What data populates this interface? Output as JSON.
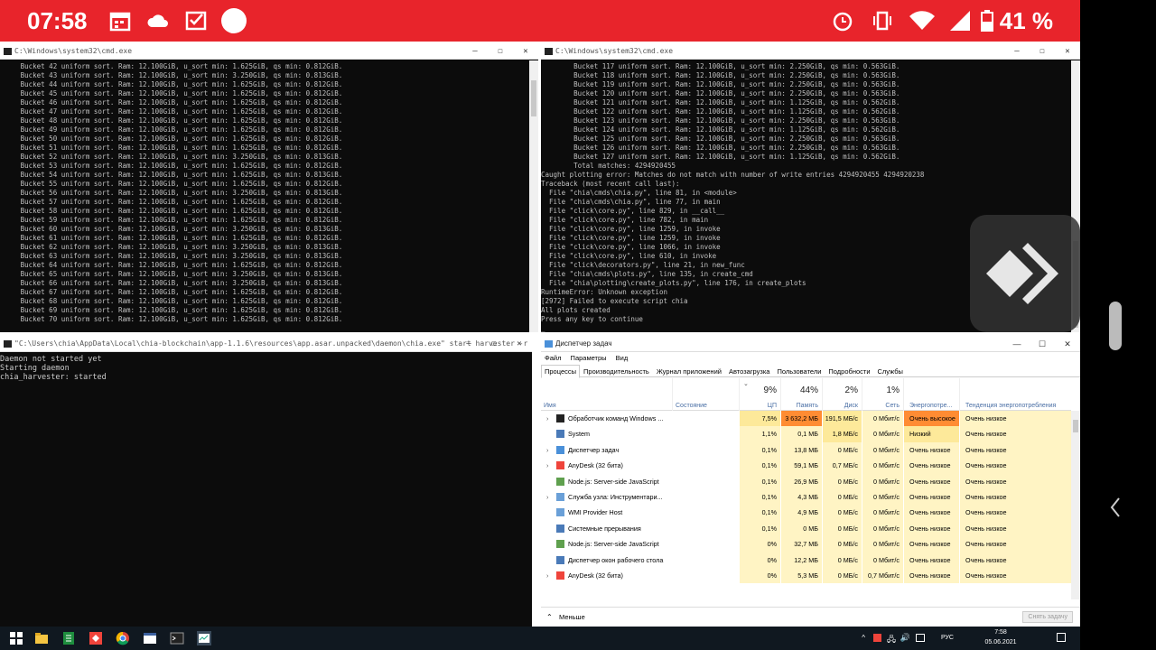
{
  "status_bar": {
    "time": "07:58",
    "battery": "41 %"
  },
  "cmd1": {
    "title": "C:\\Windows\\system32\\cmd.exe",
    "lines": [
      "     Bucket 42 uniform sort. Ram: 12.100GiB, u_sort min: 1.625GiB, qs min: 0.812GiB.",
      "     Bucket 43 uniform sort. Ram: 12.100GiB, u_sort min: 3.250GiB, qs min: 0.813GiB.",
      "     Bucket 44 uniform sort. Ram: 12.100GiB, u_sort min: 1.625GiB, qs min: 0.812GiB.",
      "     Bucket 45 uniform sort. Ram: 12.100GiB, u_sort min: 1.625GiB, qs min: 0.812GiB.",
      "     Bucket 46 uniform sort. Ram: 12.100GiB, u_sort min: 1.625GiB, qs min: 0.812GiB.",
      "     Bucket 47 uniform sort. Ram: 12.100GiB, u_sort min: 1.625GiB, qs min: 0.812GiB.",
      "     Bucket 48 uniform sort. Ram: 12.100GiB, u_sort min: 1.625GiB, qs min: 0.812GiB.",
      "     Bucket 49 uniform sort. Ram: 12.100GiB, u_sort min: 1.625GiB, qs min: 0.812GiB.",
      "     Bucket 50 uniform sort. Ram: 12.100GiB, u_sort min: 1.625GiB, qs min: 0.812GiB.",
      "     Bucket 51 uniform sort. Ram: 12.100GiB, u_sort min: 1.625GiB, qs min: 0.812GiB.",
      "     Bucket 52 uniform sort. Ram: 12.100GiB, u_sort min: 3.250GiB, qs min: 0.813GiB.",
      "     Bucket 53 uniform sort. Ram: 12.100GiB, u_sort min: 1.625GiB, qs min: 0.812GiB.",
      "     Bucket 54 uniform sort. Ram: 12.100GiB, u_sort min: 1.625GiB, qs min: 0.813GiB.",
      "     Bucket 55 uniform sort. Ram: 12.100GiB, u_sort min: 1.625GiB, qs min: 0.812GiB.",
      "     Bucket 56 uniform sort. Ram: 12.100GiB, u_sort min: 3.250GiB, qs min: 0.813GiB.",
      "     Bucket 57 uniform sort. Ram: 12.100GiB, u_sort min: 1.625GiB, qs min: 0.812GiB.",
      "     Bucket 58 uniform sort. Ram: 12.100GiB, u_sort min: 1.625GiB, qs min: 0.812GiB.",
      "     Bucket 59 uniform sort. Ram: 12.100GiB, u_sort min: 1.625GiB, qs min: 0.812GiB.",
      "     Bucket 60 uniform sort. Ram: 12.100GiB, u_sort min: 3.250GiB, qs min: 0.813GiB.",
      "     Bucket 61 uniform sort. Ram: 12.100GiB, u_sort min: 1.625GiB, qs min: 0.812GiB.",
      "     Bucket 62 uniform sort. Ram: 12.100GiB, u_sort min: 3.250GiB, qs min: 0.813GiB.",
      "     Bucket 63 uniform sort. Ram: 12.100GiB, u_sort min: 3.250GiB, qs min: 0.813GiB.",
      "     Bucket 64 uniform sort. Ram: 12.100GiB, u_sort min: 1.625GiB, qs min: 0.812GiB.",
      "     Bucket 65 uniform sort. Ram: 12.100GiB, u_sort min: 3.250GiB, qs min: 0.813GiB.",
      "     Bucket 66 uniform sort. Ram: 12.100GiB, u_sort min: 3.250GiB, qs min: 0.813GiB.",
      "     Bucket 67 uniform sort. Ram: 12.100GiB, u_sort min: 1.625GiB, qs min: 0.812GiB.",
      "     Bucket 68 uniform sort. Ram: 12.100GiB, u_sort min: 1.625GiB, qs min: 0.812GiB.",
      "     Bucket 69 uniform sort. Ram: 12.100GiB, u_sort min: 1.625GiB, qs min: 0.812GiB.",
      "     Bucket 70 uniform sort. Ram: 12.100GiB, u_sort min: 1.625GiB, qs min: 0.812GiB."
    ]
  },
  "cmd2": {
    "title": "C:\\Windows\\system32\\cmd.exe",
    "lines": [
      "        Bucket 117 uniform sort. Ram: 12.100GiB, u_sort min: 2.250GiB, qs min: 0.563GiB.",
      "        Bucket 118 uniform sort. Ram: 12.100GiB, u_sort min: 2.250GiB, qs min: 0.563GiB.",
      "        Bucket 119 uniform sort. Ram: 12.100GiB, u_sort min: 2.250GiB, qs min: 0.563GiB.",
      "        Bucket 120 uniform sort. Ram: 12.100GiB, u_sort min: 2.250GiB, qs min: 0.563GiB.",
      "        Bucket 121 uniform sort. Ram: 12.100GiB, u_sort min: 1.125GiB, qs min: 0.562GiB.",
      "        Bucket 122 uniform sort. Ram: 12.100GiB, u_sort min: 1.125GiB, qs min: 0.562GiB.",
      "        Bucket 123 uniform sort. Ram: 12.100GiB, u_sort min: 2.250GiB, qs min: 0.563GiB.",
      "        Bucket 124 uniform sort. Ram: 12.100GiB, u_sort min: 1.125GiB, qs min: 0.562GiB.",
      "        Bucket 125 uniform sort. Ram: 12.100GiB, u_sort min: 2.250GiB, qs min: 0.563GiB.",
      "        Bucket 126 uniform sort. Ram: 12.100GiB, u_sort min: 2.250GiB, qs min: 0.563GiB.",
      "        Bucket 127 uniform sort. Ram: 12.100GiB, u_sort min: 1.125GiB, qs min: 0.562GiB.",
      "        Total matches: 4294920455",
      "Caught plotting error: Matches do not match with number of write entries 4294920455 4294920238",
      "Traceback (most recent call last):",
      "  File \"chia\\cmds\\chia.py\", line 81, in <module>",
      "  File \"chia\\cmds\\chia.py\", line 77, in main",
      "  File \"click\\core.py\", line 829, in __call__",
      "  File \"click\\core.py\", line 782, in main",
      "  File \"click\\core.py\", line 1259, in invoke",
      "  File \"click\\core.py\", line 1259, in invoke",
      "  File \"click\\core.py\", line 1066, in invoke",
      "  File \"click\\core.py\", line 610, in invoke",
      "  File \"click\\decorators.py\", line 21, in new_func",
      "  File \"chia\\cmds\\plots.py\", line 135, in create_cmd",
      "  File \"chia\\plotting\\create_plots.py\", line 176, in create_plots",
      "RuntimeError: Unknown exception",
      "[2972] Failed to execute script chia",
      "All plots created",
      "Press any key to continue",
      "_"
    ]
  },
  "cmd3": {
    "title": "\"C:\\Users\\chia\\AppData\\Local\\chia-blockchain\\app-1.1.6\\resources\\app.asar.unpacked\\daemon\\chia.exe\"  start harvester -r",
    "lines": [
      "Daemon not started yet",
      "Starting daemon",
      "chia_harvester: started"
    ]
  },
  "taskmgr": {
    "title": "Диспетчер задач",
    "menu": [
      "Файл",
      "Параметры",
      "Вид"
    ],
    "tabs": [
      "Процессы",
      "Производительность",
      "Журнал приложений",
      "Автозагрузка",
      "Пользователи",
      "Подробности",
      "Службы"
    ],
    "headers": {
      "name": "Имя",
      "state": "Состояние",
      "cpu_pct": "9%",
      "cpu": "ЦП",
      "mem_pct": "44%",
      "mem": "Память",
      "disk_pct": "2%",
      "disk": "Диск",
      "net_pct": "1%",
      "net": "Сеть",
      "power": "Энергопотре...",
      "power_trend": "Тенденция энергопотребления"
    },
    "rows": [
      {
        "name": "Обработчик команд Windows ...",
        "exp": true,
        "cpu": "7,5%",
        "mem": "3 632,2 МБ",
        "disk": "191,5 МБ/с",
        "net": "0 Мбит/с",
        "power": "Очень высокое",
        "trend": "Очень низкое",
        "icon": "cmd-icon"
      },
      {
        "name": "System",
        "exp": false,
        "cpu": "1,1%",
        "mem": "0,1 МБ",
        "disk": "1,8 МБ/с",
        "net": "0 Мбит/с",
        "power": "Низкий",
        "trend": "Очень низкое",
        "icon": "system-icon"
      },
      {
        "name": "Диспетчер задач",
        "exp": true,
        "cpu": "0,1%",
        "mem": "13,8 МБ",
        "disk": "0 МБ/с",
        "net": "0 Мбит/с",
        "power": "Очень низкое",
        "trend": "Очень низкое",
        "icon": "taskmgr-icon"
      },
      {
        "name": "AnyDesk (32 бита)",
        "exp": true,
        "cpu": "0,1%",
        "mem": "59,1 МБ",
        "disk": "0,7 МБ/с",
        "net": "0 Мбит/с",
        "power": "Очень низкое",
        "trend": "Очень низкое",
        "icon": "anydesk-icon"
      },
      {
        "name": "Node.js: Server-side JavaScript",
        "exp": false,
        "cpu": "0,1%",
        "mem": "26,9 МБ",
        "disk": "0 МБ/с",
        "net": "0 Мбит/с",
        "power": "Очень низкое",
        "trend": "Очень низкое",
        "icon": "nodejs-icon"
      },
      {
        "name": "Служба узла: Инструментари...",
        "exp": true,
        "cpu": "0,1%",
        "mem": "4,3 МБ",
        "disk": "0 МБ/с",
        "net": "0 Мбит/с",
        "power": "Очень низкое",
        "trend": "Очень низкое",
        "icon": "service-icon"
      },
      {
        "name": "WMI Provider Host",
        "exp": false,
        "cpu": "0,1%",
        "mem": "4,9 МБ",
        "disk": "0 МБ/с",
        "net": "0 Мбит/с",
        "power": "Очень низкое",
        "trend": "Очень низкое",
        "icon": "service-icon"
      },
      {
        "name": "Системные прерывания",
        "exp": false,
        "cpu": "0,1%",
        "mem": "0 МБ",
        "disk": "0 МБ/с",
        "net": "0 Мбит/с",
        "power": "Очень низкое",
        "trend": "Очень низкое",
        "icon": "system-icon"
      },
      {
        "name": "Node.js: Server-side JavaScript",
        "exp": false,
        "cpu": "0%",
        "mem": "32,7 МБ",
        "disk": "0 МБ/с",
        "net": "0 Мбит/с",
        "power": "Очень низкое",
        "trend": "Очень низкое",
        "icon": "nodejs-icon"
      },
      {
        "name": "Диспетчер окон рабочего стола",
        "exp": false,
        "cpu": "0%",
        "mem": "12,2 МБ",
        "disk": "0 МБ/с",
        "net": "0 Мбит/с",
        "power": "Очень низкое",
        "trend": "Очень низкое",
        "icon": "system-icon"
      },
      {
        "name": "AnyDesk (32 бита)",
        "exp": true,
        "cpu": "0%",
        "mem": "5,3 МБ",
        "disk": "0 МБ/с",
        "net": "0,7 Мбит/с",
        "power": "Очень низкое",
        "trend": "Очень низкое",
        "icon": "anydesk-icon"
      }
    ],
    "less": "Меньше",
    "end_task": "Снять задачу"
  },
  "taskbar": {
    "lang": "РУС",
    "time": "7:58",
    "date": "05.06.2021"
  },
  "colors": {
    "statusbar": "#e8242b",
    "heat_high": "#ff8c33",
    "heat_low": "#fff4c4",
    "heat_mid": "#fde99a"
  }
}
